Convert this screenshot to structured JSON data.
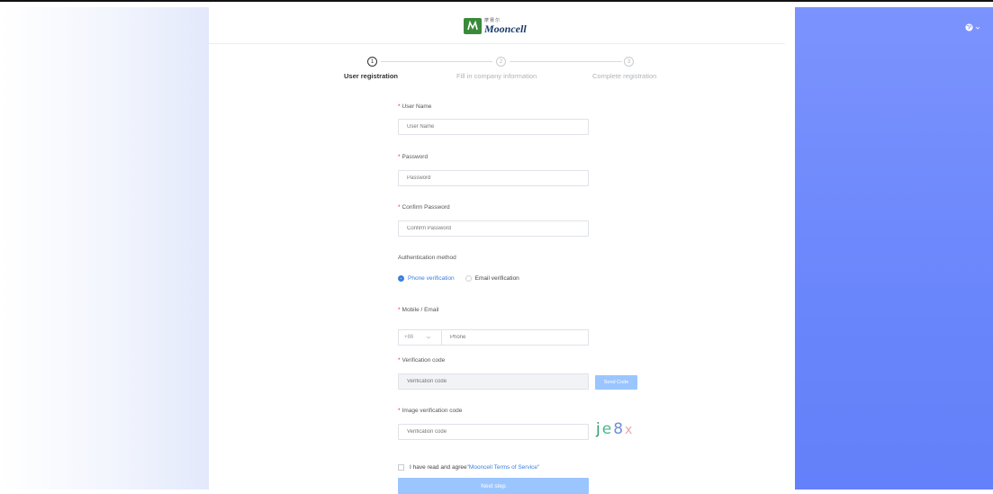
{
  "brand": {
    "name": "Mooncell",
    "chinese": "摩赛尔",
    "accent": "#3a7fe0",
    "logo_color": "#3a8a3a"
  },
  "language_icon": "globe-icon",
  "steps": [
    {
      "number": "1",
      "label": "User registration",
      "active": true
    },
    {
      "number": "2",
      "label": "Fill in company information",
      "active": false
    },
    {
      "number": "3",
      "label": "Complete registration",
      "active": false
    }
  ],
  "form": {
    "username": {
      "label": "User Name",
      "placeholder": "User Name"
    },
    "password": {
      "label": "Password",
      "placeholder": "Password"
    },
    "confirm_password": {
      "label": "Confirm Password",
      "placeholder": "Confirm Password"
    },
    "auth": {
      "label": "Authentication method",
      "options": [
        {
          "label": "Phone verification",
          "selected": true
        },
        {
          "label": "Email verification",
          "selected": false
        }
      ]
    },
    "mobile": {
      "label": "Mobile / Email",
      "prefix": "+86",
      "placeholder": "Phone"
    },
    "verification": {
      "label": "Verification code",
      "placeholder": "Verification code",
      "send_label": "Send Code"
    },
    "image_verification": {
      "label": "Image verification code",
      "placeholder": "Verification code",
      "captcha": [
        "j",
        "e",
        "8",
        "x"
      ]
    },
    "agree": {
      "text": "I have read and agree",
      "link": "\"Mooncell Terms of Service\""
    },
    "next_label": "Next step"
  }
}
